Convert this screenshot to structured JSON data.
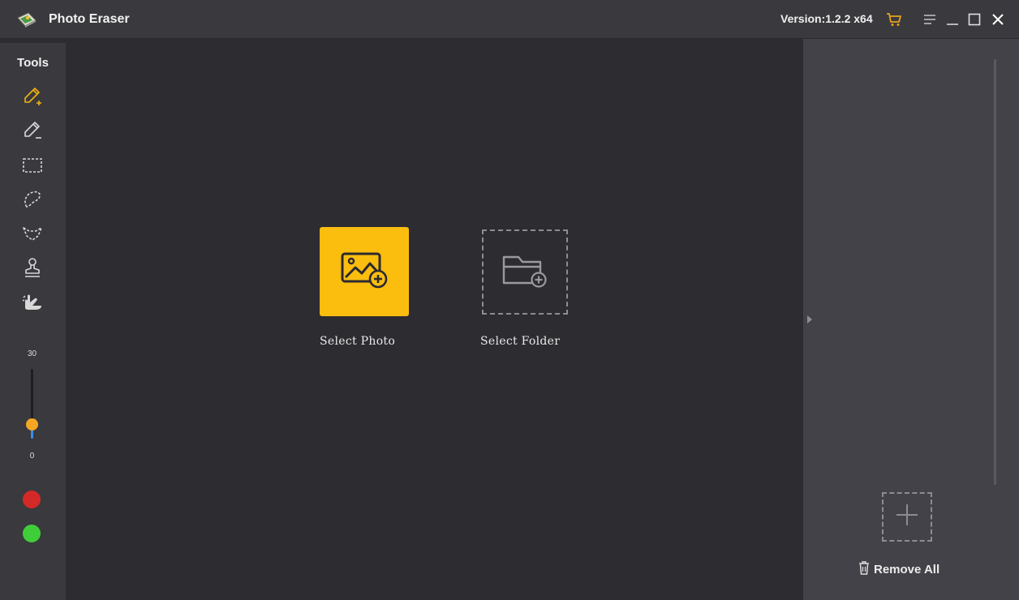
{
  "app": {
    "title": "Photo Eraser",
    "version": "Version:1.2.2 x64"
  },
  "colors": {
    "accent": "#fbbd0e",
    "panel": "#3a393e",
    "canvas": "#2d2c31",
    "right_panel": "#434248",
    "cart": "#e6a21c",
    "slider_thumb": "#f5a623",
    "slider_fill": "#3a8ee6",
    "swatch_red": "#d42a27",
    "swatch_green": "#3fce3a"
  },
  "toolbar": {
    "icons": [
      "cart-icon",
      "menu-icon",
      "minimize-icon",
      "maximize-icon",
      "close-icon"
    ]
  },
  "tools": {
    "title": "Tools",
    "items": [
      "pencil-add-icon",
      "pencil-remove-icon",
      "rectangle-select-icon",
      "lasso-icon",
      "polygon-lasso-icon",
      "stamp-icon",
      "hand-erase-icon"
    ],
    "brush_size": {
      "max": "30",
      "min": "0",
      "value": 5
    },
    "swatches": [
      "red",
      "green"
    ]
  },
  "main": {
    "select_photo_label": "Select Photo",
    "select_folder_label": "Select Folder"
  },
  "right_panel": {
    "remove_all_label": "Remove All"
  }
}
